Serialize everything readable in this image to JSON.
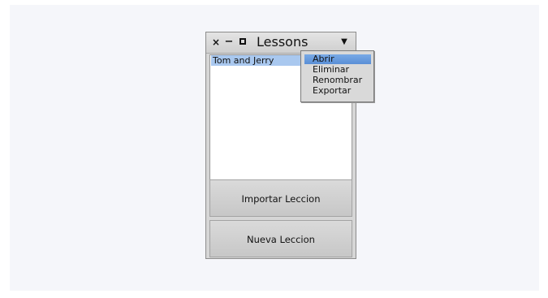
{
  "window": {
    "title": "Lessons",
    "close_glyph": "×",
    "minimize_glyph": "−",
    "menu_glyph": "▼"
  },
  "lessons_list": {
    "items": [
      {
        "label": "Tom and Jerry",
        "selected": true
      }
    ]
  },
  "buttons": {
    "import_label": "Importar Leccion",
    "new_label": "Nueva Leccion"
  },
  "context_menu": {
    "items": [
      {
        "label": "Abrir",
        "highlighted": true
      },
      {
        "label": "Eliminar",
        "highlighted": false
      },
      {
        "label": "Renombrar",
        "highlighted": false
      },
      {
        "label": "Exportar",
        "highlighted": false
      }
    ]
  },
  "colors": {
    "selection": "#a9c8ef",
    "menu_highlight": "#5a8fd6",
    "window_bg": "#d6d6d6"
  }
}
